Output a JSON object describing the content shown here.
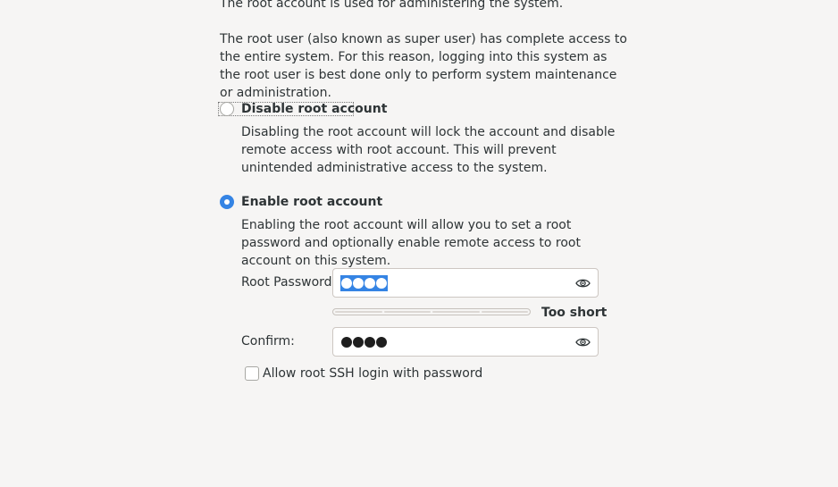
{
  "intro": {
    "line1": "The root account is used for administering the system.",
    "line2": "The root user (also known as super user) has complete access to the entire system. For this reason, logging into this system as the root user is best done only to perform system maintenance or administration."
  },
  "disable_option": {
    "label": "Disable root account",
    "selected": false,
    "description": "Disabling the root account will lock the account and disable remote access with root account. This will prevent unintended administrative access to the system."
  },
  "enable_option": {
    "label": "Enable root account",
    "selected": true,
    "description": "Enabling the root account will allow you to set a root password and optionally enable remote access to root account on this system."
  },
  "password": {
    "label": "Root Password:",
    "masked_length": 4,
    "text_selected": true,
    "strength_text": "Too short",
    "strength_level": 0
  },
  "confirm": {
    "label": "Confirm:",
    "masked_length": 4
  },
  "ssh": {
    "label": "Allow root SSH login with password",
    "checked": false
  },
  "colors": {
    "accent": "#3584e4",
    "background": "#f6f5f4",
    "text": "#2e3436"
  },
  "icons": {
    "reveal": "eye-icon"
  }
}
